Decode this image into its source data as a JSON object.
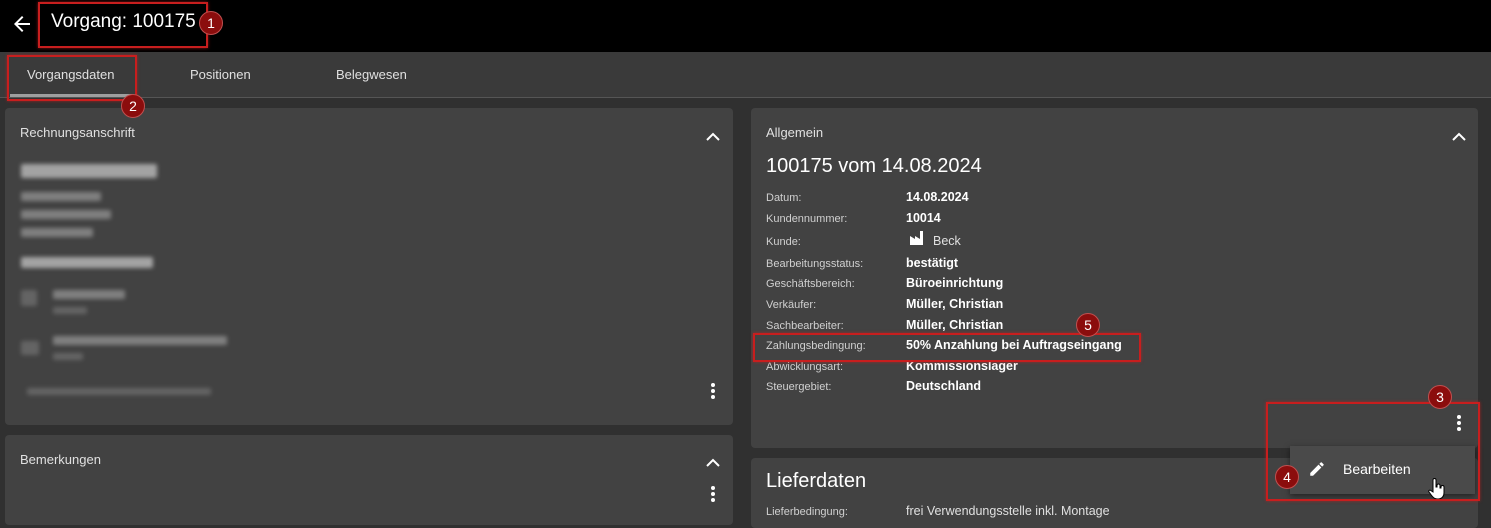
{
  "header": {
    "title": "Vorgang: 100175"
  },
  "tabs": [
    {
      "label": "Vorgangsdaten"
    },
    {
      "label": "Positionen"
    },
    {
      "label": "Belegwesen"
    }
  ],
  "billing": {
    "title": "Rechnungsanschrift"
  },
  "remarks": {
    "title": "Bemerkungen"
  },
  "general": {
    "title": "Allgemein",
    "heading": "100175 vom 14.08.2024",
    "fields": [
      {
        "label": "Datum:",
        "value": "14.08.2024"
      },
      {
        "label": "Kundennummer:",
        "value": "10014"
      },
      {
        "label": "Kunde:",
        "value": "Beck"
      },
      {
        "label": "Bearbeitungsstatus:",
        "value": "bestätigt"
      },
      {
        "label": "Geschäftsbereich:",
        "value": "Büroeinrichtung"
      },
      {
        "label": "Verkäufer:",
        "value": "Müller, Christian"
      },
      {
        "label": "Sachbearbeiter:",
        "value": "Müller, Christian"
      },
      {
        "label": "Zahlungsbedingung:",
        "value": "50% Anzahlung bei Auftragseingang"
      },
      {
        "label": "Abwicklungsart:",
        "value": "Kommissionslager"
      },
      {
        "label": "Steuergebiet:",
        "value": "Deutschland"
      }
    ]
  },
  "delivery": {
    "title": "Lieferdaten",
    "fields": [
      {
        "label": "Lieferbedingung:",
        "value": "frei Verwendungsstelle inkl. Montage"
      }
    ]
  },
  "context_menu": {
    "items": [
      {
        "label": "Bearbeiten",
        "icon": "pencil-icon"
      }
    ]
  },
  "annotations": [
    "1",
    "2",
    "3",
    "4",
    "5"
  ],
  "colors": {
    "annotation_red": "#c81e1e",
    "badge_fill": "#8b0d0d",
    "card_bg": "#424242",
    "page_bg": "#303030"
  }
}
